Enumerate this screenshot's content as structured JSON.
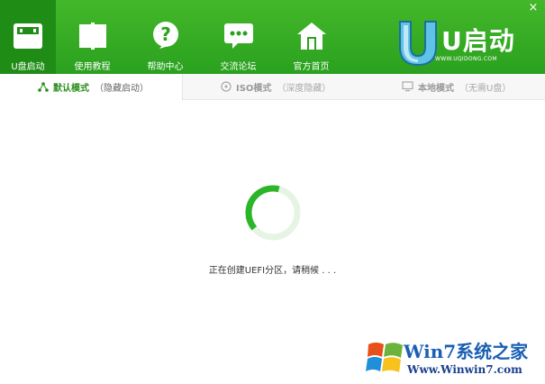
{
  "window": {
    "close_glyph": "×"
  },
  "nav": {
    "items": [
      {
        "label": "U盘启动",
        "icon": "usb-drive-icon",
        "active": true
      },
      {
        "label": "使用教程",
        "icon": "book-icon"
      },
      {
        "label": "帮助中心",
        "icon": "help-icon"
      },
      {
        "label": "交流论坛",
        "icon": "chat-bubble-icon"
      },
      {
        "label": "官方首页",
        "icon": "home-icon"
      }
    ]
  },
  "logo": {
    "text": "U启动",
    "url": "WWW.UQIDONG.COM"
  },
  "tabs": [
    {
      "label": "默认模式",
      "sub": "（隐藏启动）",
      "icon": "share-nodes-icon",
      "active": true
    },
    {
      "label": "ISO模式",
      "sub": "（深度隐藏）",
      "icon": "disc-icon"
    },
    {
      "label": "本地模式",
      "sub": "（无需U盘）",
      "icon": "monitor-icon"
    }
  ],
  "status": {
    "text": "正在创建UEFI分区，请稍候 . . ."
  },
  "progress": {
    "fraction": 0.4
  },
  "watermark": {
    "line1": "Win7系统之家",
    "line2": "Www.Winwin7.com"
  },
  "colors": {
    "brand": "#2aa11f",
    "active_nav": "#1f8c16",
    "spinner": "#2db52a",
    "spinner_track": "#e6f5e3"
  }
}
